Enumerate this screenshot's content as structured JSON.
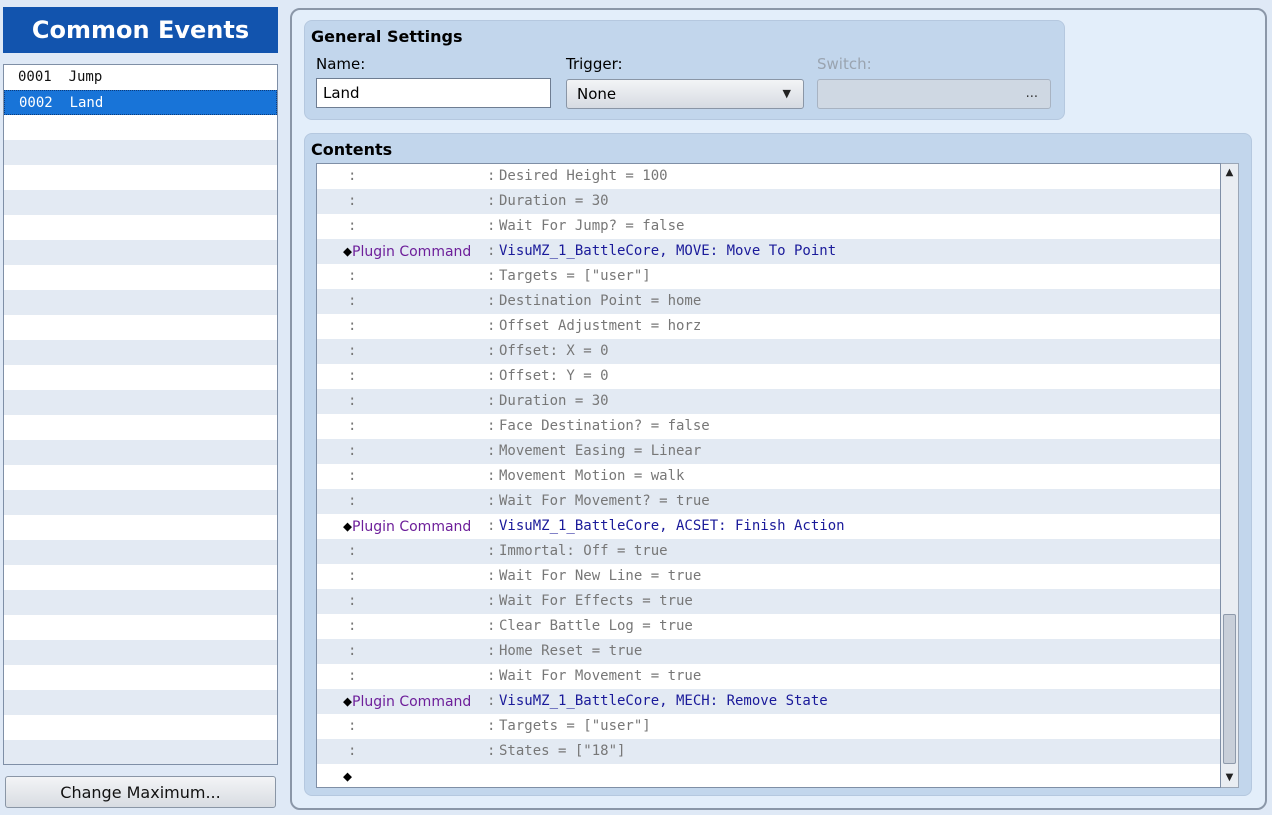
{
  "sidebar": {
    "title": "Common Events",
    "events": [
      {
        "id": "0001",
        "name": "Jump"
      },
      {
        "id": "0002",
        "name": "Land"
      }
    ],
    "change_maximum_label": "Change Maximum..."
  },
  "general_settings": {
    "title": "General Settings",
    "name_label": "Name:",
    "name_value": "Land",
    "trigger_label": "Trigger:",
    "trigger_value": "None",
    "switch_label": "Switch:",
    "switch_button": "..."
  },
  "contents": {
    "title": "Contents",
    "lines": [
      {
        "kind": "param",
        "text": "Desired Height = 100"
      },
      {
        "kind": "param",
        "text": "Duration = 30"
      },
      {
        "kind": "param",
        "text": "Wait For Jump? = false"
      },
      {
        "kind": "command",
        "label": "Plugin Command",
        "text": "VisuMZ_1_BattleCore, MOVE: Move To Point"
      },
      {
        "kind": "param",
        "text": "Targets = [\"user\"]"
      },
      {
        "kind": "param",
        "text": "Destination Point = home"
      },
      {
        "kind": "param",
        "text": "Offset Adjustment = horz"
      },
      {
        "kind": "param",
        "text": "Offset: X = 0"
      },
      {
        "kind": "param",
        "text": "Offset: Y = 0"
      },
      {
        "kind": "param",
        "text": "Duration = 30"
      },
      {
        "kind": "param",
        "text": "Face Destination? = false"
      },
      {
        "kind": "param",
        "text": "Movement Easing = Linear"
      },
      {
        "kind": "param",
        "text": "Movement Motion = walk"
      },
      {
        "kind": "param",
        "text": "Wait For Movement? = true"
      },
      {
        "kind": "command",
        "label": "Plugin Command",
        "text": "VisuMZ_1_BattleCore, ACSET: Finish Action"
      },
      {
        "kind": "param",
        "text": "Immortal: Off = true"
      },
      {
        "kind": "param",
        "text": "Wait For New Line = true"
      },
      {
        "kind": "param",
        "text": "Wait For Effects = true"
      },
      {
        "kind": "param",
        "text": "Clear Battle Log = true"
      },
      {
        "kind": "param",
        "text": "Home Reset = true"
      },
      {
        "kind": "param",
        "text": "Wait For Movement = true"
      },
      {
        "kind": "command",
        "label": "Plugin Command",
        "text": "VisuMZ_1_BattleCore, MECH: Remove State"
      },
      {
        "kind": "param",
        "text": "Targets = [\"user\"]"
      },
      {
        "kind": "param",
        "text": "States = [\"18\"]"
      },
      {
        "kind": "end",
        "text": ""
      }
    ]
  },
  "icons": {
    "command_marker": "diamond-icon",
    "scroll_up": "arrow-up-icon",
    "scroll_down": "arrow-down-icon",
    "dropdown": "chevron-down-icon"
  },
  "colors": {
    "title_bar": "#1254ae",
    "selection": "#1874d8",
    "command_label": "#6d1f9a",
    "command_value": "#1a1a9a"
  }
}
